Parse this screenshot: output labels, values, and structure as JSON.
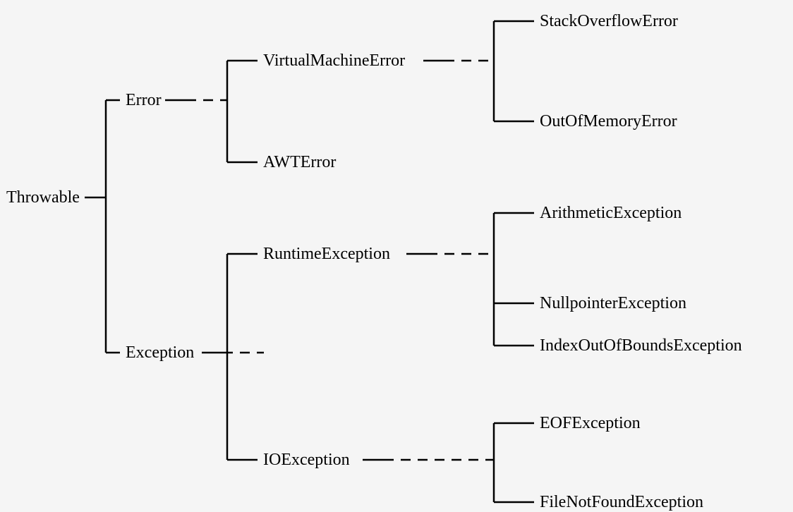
{
  "tree": {
    "root": "Throwable",
    "error": "Error",
    "vmerror": "VirtualMachineError",
    "stackoverflow": "StackOverflowError",
    "outofmemory": "OutOfMemoryError",
    "awterror": "AWTError",
    "exception": "Exception",
    "runtime": "RuntimeException",
    "arithmetic": "ArithmeticException",
    "nullpointer": "NullpointerException",
    "indexoob": "IndexOutOfBoundsException",
    "ioexception": "IOException",
    "eof": "EOFException",
    "filenotfound": "FileNotFoundException"
  }
}
